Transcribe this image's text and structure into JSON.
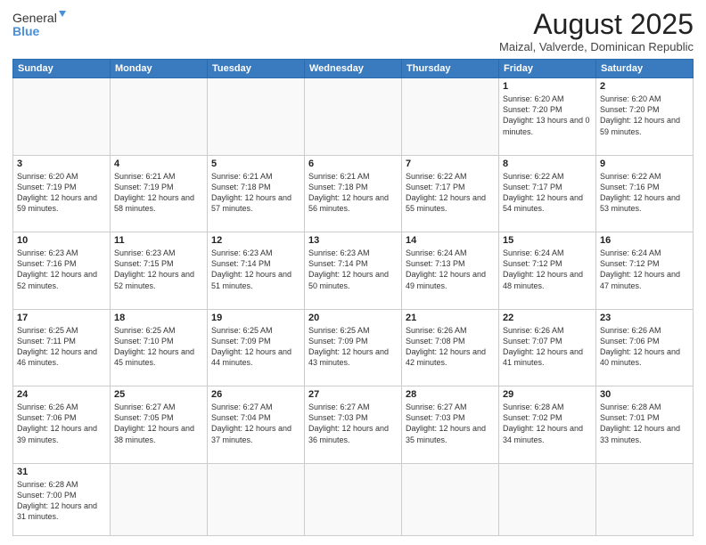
{
  "logo": {
    "text_general": "General",
    "text_blue": "Blue"
  },
  "header": {
    "title": "August 2025",
    "subtitle": "Maizal, Valverde, Dominican Republic"
  },
  "weekdays": [
    "Sunday",
    "Monday",
    "Tuesday",
    "Wednesday",
    "Thursday",
    "Friday",
    "Saturday"
  ],
  "weeks": [
    [
      {
        "day": "",
        "info": ""
      },
      {
        "day": "",
        "info": ""
      },
      {
        "day": "",
        "info": ""
      },
      {
        "day": "",
        "info": ""
      },
      {
        "day": "",
        "info": ""
      },
      {
        "day": "1",
        "info": "Sunrise: 6:20 AM\nSunset: 7:20 PM\nDaylight: 13 hours\nand 0 minutes."
      },
      {
        "day": "2",
        "info": "Sunrise: 6:20 AM\nSunset: 7:20 PM\nDaylight: 12 hours\nand 59 minutes."
      }
    ],
    [
      {
        "day": "3",
        "info": "Sunrise: 6:20 AM\nSunset: 7:19 PM\nDaylight: 12 hours\nand 59 minutes."
      },
      {
        "day": "4",
        "info": "Sunrise: 6:21 AM\nSunset: 7:19 PM\nDaylight: 12 hours\nand 58 minutes."
      },
      {
        "day": "5",
        "info": "Sunrise: 6:21 AM\nSunset: 7:18 PM\nDaylight: 12 hours\nand 57 minutes."
      },
      {
        "day": "6",
        "info": "Sunrise: 6:21 AM\nSunset: 7:18 PM\nDaylight: 12 hours\nand 56 minutes."
      },
      {
        "day": "7",
        "info": "Sunrise: 6:22 AM\nSunset: 7:17 PM\nDaylight: 12 hours\nand 55 minutes."
      },
      {
        "day": "8",
        "info": "Sunrise: 6:22 AM\nSunset: 7:17 PM\nDaylight: 12 hours\nand 54 minutes."
      },
      {
        "day": "9",
        "info": "Sunrise: 6:22 AM\nSunset: 7:16 PM\nDaylight: 12 hours\nand 53 minutes."
      }
    ],
    [
      {
        "day": "10",
        "info": "Sunrise: 6:23 AM\nSunset: 7:16 PM\nDaylight: 12 hours\nand 52 minutes."
      },
      {
        "day": "11",
        "info": "Sunrise: 6:23 AM\nSunset: 7:15 PM\nDaylight: 12 hours\nand 52 minutes."
      },
      {
        "day": "12",
        "info": "Sunrise: 6:23 AM\nSunset: 7:14 PM\nDaylight: 12 hours\nand 51 minutes."
      },
      {
        "day": "13",
        "info": "Sunrise: 6:23 AM\nSunset: 7:14 PM\nDaylight: 12 hours\nand 50 minutes."
      },
      {
        "day": "14",
        "info": "Sunrise: 6:24 AM\nSunset: 7:13 PM\nDaylight: 12 hours\nand 49 minutes."
      },
      {
        "day": "15",
        "info": "Sunrise: 6:24 AM\nSunset: 7:12 PM\nDaylight: 12 hours\nand 48 minutes."
      },
      {
        "day": "16",
        "info": "Sunrise: 6:24 AM\nSunset: 7:12 PM\nDaylight: 12 hours\nand 47 minutes."
      }
    ],
    [
      {
        "day": "17",
        "info": "Sunrise: 6:25 AM\nSunset: 7:11 PM\nDaylight: 12 hours\nand 46 minutes."
      },
      {
        "day": "18",
        "info": "Sunrise: 6:25 AM\nSunset: 7:10 PM\nDaylight: 12 hours\nand 45 minutes."
      },
      {
        "day": "19",
        "info": "Sunrise: 6:25 AM\nSunset: 7:09 PM\nDaylight: 12 hours\nand 44 minutes."
      },
      {
        "day": "20",
        "info": "Sunrise: 6:25 AM\nSunset: 7:09 PM\nDaylight: 12 hours\nand 43 minutes."
      },
      {
        "day": "21",
        "info": "Sunrise: 6:26 AM\nSunset: 7:08 PM\nDaylight: 12 hours\nand 42 minutes."
      },
      {
        "day": "22",
        "info": "Sunrise: 6:26 AM\nSunset: 7:07 PM\nDaylight: 12 hours\nand 41 minutes."
      },
      {
        "day": "23",
        "info": "Sunrise: 6:26 AM\nSunset: 7:06 PM\nDaylight: 12 hours\nand 40 minutes."
      }
    ],
    [
      {
        "day": "24",
        "info": "Sunrise: 6:26 AM\nSunset: 7:06 PM\nDaylight: 12 hours\nand 39 minutes."
      },
      {
        "day": "25",
        "info": "Sunrise: 6:27 AM\nSunset: 7:05 PM\nDaylight: 12 hours\nand 38 minutes."
      },
      {
        "day": "26",
        "info": "Sunrise: 6:27 AM\nSunset: 7:04 PM\nDaylight: 12 hours\nand 37 minutes."
      },
      {
        "day": "27",
        "info": "Sunrise: 6:27 AM\nSunset: 7:03 PM\nDaylight: 12 hours\nand 36 minutes."
      },
      {
        "day": "28",
        "info": "Sunrise: 6:27 AM\nSunset: 7:03 PM\nDaylight: 12 hours\nand 35 minutes."
      },
      {
        "day": "29",
        "info": "Sunrise: 6:28 AM\nSunset: 7:02 PM\nDaylight: 12 hours\nand 34 minutes."
      },
      {
        "day": "30",
        "info": "Sunrise: 6:28 AM\nSunset: 7:01 PM\nDaylight: 12 hours\nand 33 minutes."
      }
    ],
    [
      {
        "day": "31",
        "info": "Sunrise: 6:28 AM\nSunset: 7:00 PM\nDaylight: 12 hours\nand 31 minutes."
      },
      {
        "day": "",
        "info": ""
      },
      {
        "day": "",
        "info": ""
      },
      {
        "day": "",
        "info": ""
      },
      {
        "day": "",
        "info": ""
      },
      {
        "day": "",
        "info": ""
      },
      {
        "day": "",
        "info": ""
      }
    ]
  ]
}
